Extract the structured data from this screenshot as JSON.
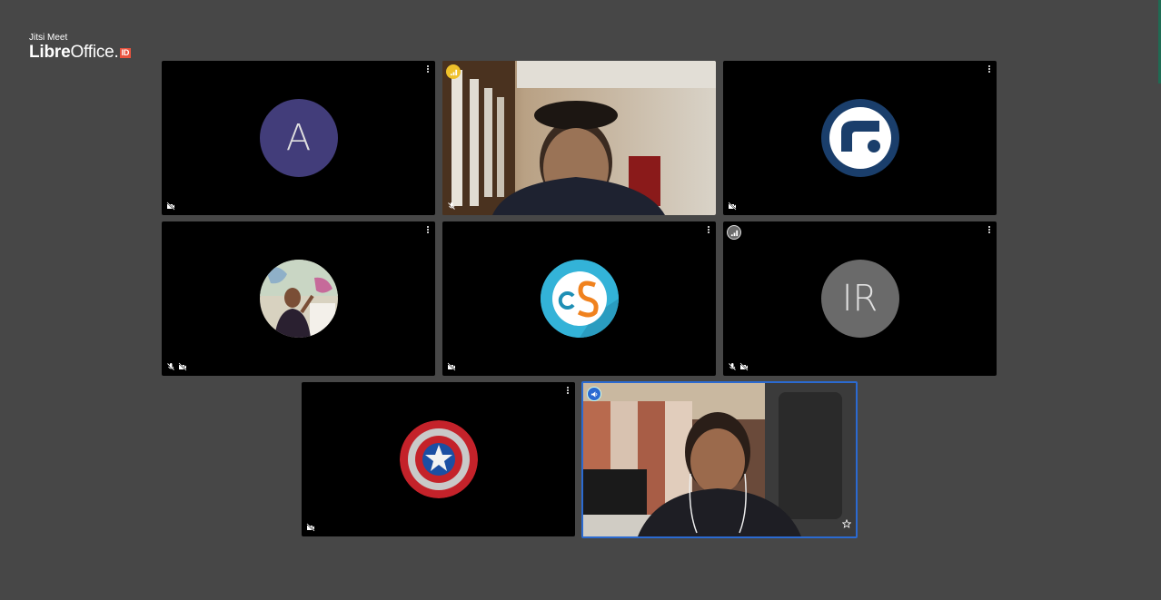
{
  "branding": {
    "subtitle": "Jitsi Meet",
    "name_bold": "Libre",
    "name_regular": "Office.",
    "badge": "ID"
  },
  "participants": [
    {
      "avatar_type": "initials",
      "initials": "A",
      "avatar_color": "#423d7a",
      "audio_muted": false,
      "video_muted": true
    },
    {
      "avatar_type": "video",
      "connection": "good",
      "connection_color": "#efc12a",
      "audio_muted": true,
      "video_muted": false
    },
    {
      "avatar_type": "logo",
      "logo_icon": "libreoffice-id-logo",
      "avatar_color": "#1a3e6b",
      "audio_muted": false,
      "video_muted": true
    },
    {
      "avatar_type": "photo",
      "photo_icon": "person-photo",
      "audio_muted": true,
      "video_muted": true
    },
    {
      "avatar_type": "logo",
      "logo_icon": "cs-logo",
      "avatar_color": "#33b3d8",
      "audio_muted": false,
      "video_muted": true
    },
    {
      "avatar_type": "initials",
      "initials": "IR",
      "avatar_color": "#6a6a6a",
      "connection": "neutral",
      "audio_muted": true,
      "video_muted": true
    },
    {
      "avatar_type": "logo",
      "logo_icon": "captain-america-shield",
      "audio_muted": false,
      "video_muted": true
    },
    {
      "avatar_type": "video",
      "connection": "dominant-speaker",
      "connection_color": "#2b6ad1",
      "active_speaker": true,
      "moderator_star": true,
      "audio_muted": false,
      "video_muted": false
    }
  ],
  "colors": {
    "background": "#474747",
    "active_border": "#2b6ad1"
  }
}
